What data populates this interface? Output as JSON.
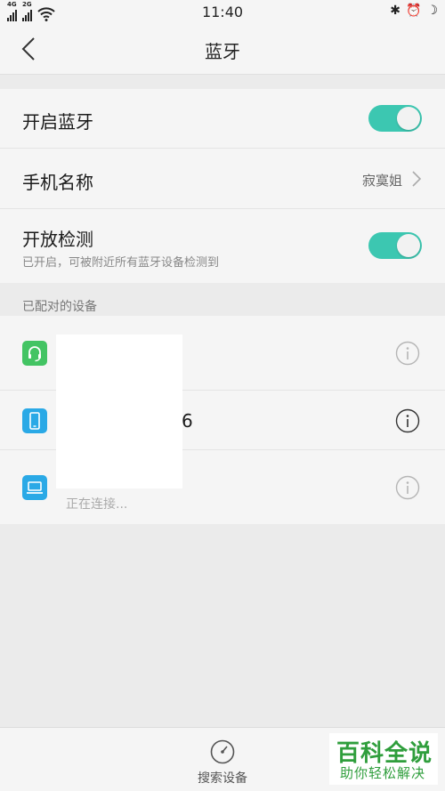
{
  "status_bar": {
    "signal1_label": "4G",
    "signal2_label": "2G",
    "time": "11:40",
    "bluetooth_glyph": "✱",
    "alarm_glyph": "⏰",
    "moon_glyph": "☽"
  },
  "nav": {
    "title": "蓝牙"
  },
  "settings": {
    "bluetooth": {
      "label": "开启蓝牙",
      "enabled": true
    },
    "phone_name": {
      "label": "手机名称",
      "value": "寂寞姐"
    },
    "visibility": {
      "label": "开放检测",
      "sublabel": "已开启，可被附近所有蓝牙设备检测到",
      "enabled": true
    }
  },
  "paired": {
    "section_label": "已配对的设备",
    "devices": [
      {
        "icon": "headset-icon",
        "name": "",
        "status": ""
      },
      {
        "icon": "phone-icon",
        "name": "6",
        "status": ""
      },
      {
        "icon": "laptop-icon",
        "name": "",
        "status": "正在连接..."
      }
    ]
  },
  "bottom": {
    "search_label": "搜索设备"
  },
  "watermark": {
    "top": "百科全说",
    "bottom": "助你轻松解决"
  },
  "colors": {
    "toggle_on": "#3cc7b1",
    "headset_icon_bg": "#43c463",
    "phone_icon_bg": "#2aa9e6",
    "laptop_icon_bg": "#2aa9e6",
    "watermark": "#2f9e3c"
  }
}
